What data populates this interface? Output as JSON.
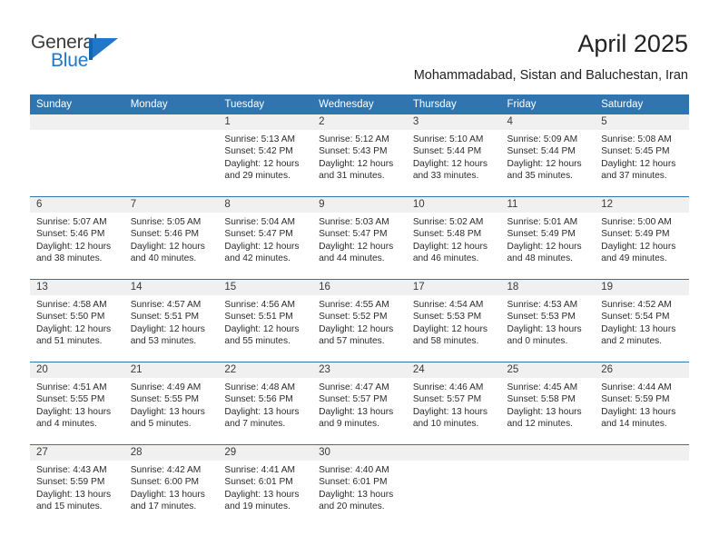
{
  "brand": {
    "name_part1": "General",
    "name_part2": "Blue",
    "flag_icon": "flag-triangle-icon",
    "accent_color": "#2277c8"
  },
  "header": {
    "title": "April 2025",
    "location": "Mohammadabad, Sistan and Baluchestan, Iran"
  },
  "theme": {
    "header_row_color": "#3175b0",
    "day_band_color": "#f0f0f0",
    "separator_color": "#3175b0",
    "text_color": "#2b2b2b"
  },
  "calendar": {
    "weekday_headers": [
      "Sunday",
      "Monday",
      "Tuesday",
      "Wednesday",
      "Thursday",
      "Friday",
      "Saturday"
    ],
    "weeks": [
      [
        {
          "day": "",
          "empty": true
        },
        {
          "day": "",
          "empty": true
        },
        {
          "day": "1",
          "sunrise": "Sunrise: 5:13 AM",
          "sunset": "Sunset: 5:42 PM",
          "daylight": "Daylight: 12 hours and 29 minutes."
        },
        {
          "day": "2",
          "sunrise": "Sunrise: 5:12 AM",
          "sunset": "Sunset: 5:43 PM",
          "daylight": "Daylight: 12 hours and 31 minutes."
        },
        {
          "day": "3",
          "sunrise": "Sunrise: 5:10 AM",
          "sunset": "Sunset: 5:44 PM",
          "daylight": "Daylight: 12 hours and 33 minutes."
        },
        {
          "day": "4",
          "sunrise": "Sunrise: 5:09 AM",
          "sunset": "Sunset: 5:44 PM",
          "daylight": "Daylight: 12 hours and 35 minutes."
        },
        {
          "day": "5",
          "sunrise": "Sunrise: 5:08 AM",
          "sunset": "Sunset: 5:45 PM",
          "daylight": "Daylight: 12 hours and 37 minutes."
        }
      ],
      [
        {
          "day": "6",
          "sunrise": "Sunrise: 5:07 AM",
          "sunset": "Sunset: 5:46 PM",
          "daylight": "Daylight: 12 hours and 38 minutes."
        },
        {
          "day": "7",
          "sunrise": "Sunrise: 5:05 AM",
          "sunset": "Sunset: 5:46 PM",
          "daylight": "Daylight: 12 hours and 40 minutes."
        },
        {
          "day": "8",
          "sunrise": "Sunrise: 5:04 AM",
          "sunset": "Sunset: 5:47 PM",
          "daylight": "Daylight: 12 hours and 42 minutes."
        },
        {
          "day": "9",
          "sunrise": "Sunrise: 5:03 AM",
          "sunset": "Sunset: 5:47 PM",
          "daylight": "Daylight: 12 hours and 44 minutes."
        },
        {
          "day": "10",
          "sunrise": "Sunrise: 5:02 AM",
          "sunset": "Sunset: 5:48 PM",
          "daylight": "Daylight: 12 hours and 46 minutes."
        },
        {
          "day": "11",
          "sunrise": "Sunrise: 5:01 AM",
          "sunset": "Sunset: 5:49 PM",
          "daylight": "Daylight: 12 hours and 48 minutes."
        },
        {
          "day": "12",
          "sunrise": "Sunrise: 5:00 AM",
          "sunset": "Sunset: 5:49 PM",
          "daylight": "Daylight: 12 hours and 49 minutes."
        }
      ],
      [
        {
          "day": "13",
          "sunrise": "Sunrise: 4:58 AM",
          "sunset": "Sunset: 5:50 PM",
          "daylight": "Daylight: 12 hours and 51 minutes."
        },
        {
          "day": "14",
          "sunrise": "Sunrise: 4:57 AM",
          "sunset": "Sunset: 5:51 PM",
          "daylight": "Daylight: 12 hours and 53 minutes."
        },
        {
          "day": "15",
          "sunrise": "Sunrise: 4:56 AM",
          "sunset": "Sunset: 5:51 PM",
          "daylight": "Daylight: 12 hours and 55 minutes."
        },
        {
          "day": "16",
          "sunrise": "Sunrise: 4:55 AM",
          "sunset": "Sunset: 5:52 PM",
          "daylight": "Daylight: 12 hours and 57 minutes."
        },
        {
          "day": "17",
          "sunrise": "Sunrise: 4:54 AM",
          "sunset": "Sunset: 5:53 PM",
          "daylight": "Daylight: 12 hours and 58 minutes."
        },
        {
          "day": "18",
          "sunrise": "Sunrise: 4:53 AM",
          "sunset": "Sunset: 5:53 PM",
          "daylight": "Daylight: 13 hours and 0 minutes."
        },
        {
          "day": "19",
          "sunrise": "Sunrise: 4:52 AM",
          "sunset": "Sunset: 5:54 PM",
          "daylight": "Daylight: 13 hours and 2 minutes."
        }
      ],
      [
        {
          "day": "20",
          "sunrise": "Sunrise: 4:51 AM",
          "sunset": "Sunset: 5:55 PM",
          "daylight": "Daylight: 13 hours and 4 minutes."
        },
        {
          "day": "21",
          "sunrise": "Sunrise: 4:49 AM",
          "sunset": "Sunset: 5:55 PM",
          "daylight": "Daylight: 13 hours and 5 minutes."
        },
        {
          "day": "22",
          "sunrise": "Sunrise: 4:48 AM",
          "sunset": "Sunset: 5:56 PM",
          "daylight": "Daylight: 13 hours and 7 minutes."
        },
        {
          "day": "23",
          "sunrise": "Sunrise: 4:47 AM",
          "sunset": "Sunset: 5:57 PM",
          "daylight": "Daylight: 13 hours and 9 minutes."
        },
        {
          "day": "24",
          "sunrise": "Sunrise: 4:46 AM",
          "sunset": "Sunset: 5:57 PM",
          "daylight": "Daylight: 13 hours and 10 minutes."
        },
        {
          "day": "25",
          "sunrise": "Sunrise: 4:45 AM",
          "sunset": "Sunset: 5:58 PM",
          "daylight": "Daylight: 13 hours and 12 minutes."
        },
        {
          "day": "26",
          "sunrise": "Sunrise: 4:44 AM",
          "sunset": "Sunset: 5:59 PM",
          "daylight": "Daylight: 13 hours and 14 minutes."
        }
      ],
      [
        {
          "day": "27",
          "sunrise": "Sunrise: 4:43 AM",
          "sunset": "Sunset: 5:59 PM",
          "daylight": "Daylight: 13 hours and 15 minutes."
        },
        {
          "day": "28",
          "sunrise": "Sunrise: 4:42 AM",
          "sunset": "Sunset: 6:00 PM",
          "daylight": "Daylight: 13 hours and 17 minutes."
        },
        {
          "day": "29",
          "sunrise": "Sunrise: 4:41 AM",
          "sunset": "Sunset: 6:01 PM",
          "daylight": "Daylight: 13 hours and 19 minutes."
        },
        {
          "day": "30",
          "sunrise": "Sunrise: 4:40 AM",
          "sunset": "Sunset: 6:01 PM",
          "daylight": "Daylight: 13 hours and 20 minutes."
        },
        {
          "day": "",
          "empty": true
        },
        {
          "day": "",
          "empty": true
        },
        {
          "day": "",
          "empty": true
        }
      ]
    ]
  }
}
